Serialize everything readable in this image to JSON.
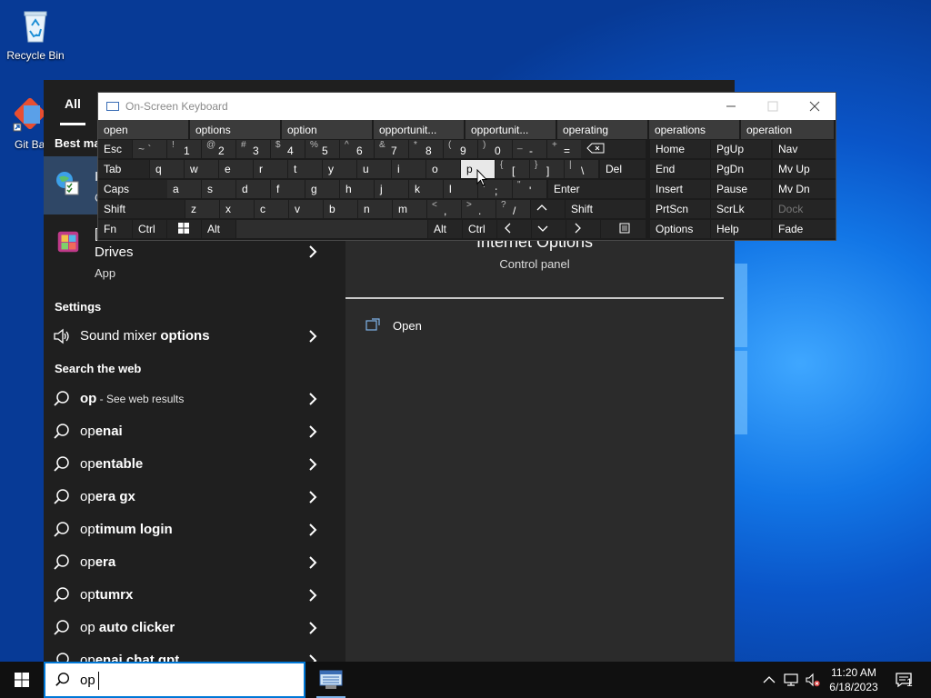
{
  "desktop": {
    "icons": [
      {
        "label": "Recycle Bin"
      },
      {
        "label": "Git Ba"
      }
    ]
  },
  "search_panel": {
    "tabs": {
      "all": "All"
    },
    "best_match_header": "Best ma",
    "best_item": {
      "letter1": "I",
      "letter2": "C"
    },
    "drives_item": {
      "line0": "[",
      "title": "Drives",
      "subtitle": "App"
    },
    "settings_header": "Settings",
    "settings_item": {
      "label_pre": "Sound mixer ",
      "label_bold": "options"
    },
    "web_header": "Search the web",
    "web_first": {
      "bold": "op",
      "suffix": " - See web results"
    },
    "web_results": [
      {
        "pre": "op",
        "bold": "enai"
      },
      {
        "pre": "op",
        "bold": "entable"
      },
      {
        "pre": "op",
        "bold": "era gx"
      },
      {
        "pre": "op",
        "bold": "timum login"
      },
      {
        "pre": "op",
        "bold": "era"
      },
      {
        "pre": "op",
        "bold": "tumrx"
      },
      {
        "pre": "op",
        "bold": " auto clicker"
      },
      {
        "pre": "op",
        "bold": "enai chat gpt"
      }
    ],
    "right": {
      "title": "Internet Options",
      "subtitle": "Control panel",
      "open_label": "Open"
    }
  },
  "osk": {
    "title": "On-Screen Keyboard",
    "predictions": [
      "open",
      "options",
      "option",
      "opportunit...",
      "opportunit...",
      "operating",
      "operations",
      "operation"
    ],
    "keys": {
      "esc": "Esc",
      "tab": "Tab",
      "caps": "Caps",
      "shift": "Shift",
      "fn": "Fn",
      "ctrl": "Ctrl",
      "alt": "Alt",
      "del": "Del",
      "enter": "Enter",
      "home": "Home",
      "pgup": "PgUp",
      "nav": "Nav",
      "end": "End",
      "pgdn": "PgDn",
      "mvup": "Mv Up",
      "insert": "Insert",
      "pause": "Pause",
      "mvdn": "Mv Dn",
      "prtscn": "PrtScn",
      "scrlk": "ScrLk",
      "dock": "Dock",
      "options": "Options",
      "help": "Help",
      "fade": "Fade",
      "tilde": "~ `",
      "num_row": [
        [
          "!",
          "1"
        ],
        [
          "@",
          "2"
        ],
        [
          "#",
          "3"
        ],
        [
          "$",
          "4"
        ],
        [
          "%",
          "5"
        ],
        [
          "^",
          "6"
        ],
        [
          "&",
          "7"
        ],
        [
          "*",
          "8"
        ],
        [
          "(",
          "9"
        ],
        [
          ")",
          "0"
        ],
        [
          "_",
          "-"
        ],
        [
          "+",
          "="
        ]
      ],
      "row_q": [
        "q",
        "w",
        "e",
        "r",
        "t",
        "y",
        "u",
        "i",
        "o",
        "p"
      ],
      "row_q_sym": [
        [
          "{",
          "["
        ],
        [
          "}",
          "]"
        ],
        [
          "|",
          "\\"
        ]
      ],
      "row_a": [
        "a",
        "s",
        "d",
        "f",
        "g",
        "h",
        "j",
        "k",
        "l"
      ],
      "row_a_sym": [
        [
          ":",
          ";"
        ],
        [
          "\"",
          "'"
        ]
      ],
      "row_z": [
        "z",
        "x",
        "c",
        "v",
        "b",
        "n",
        "m"
      ],
      "row_z_sym": [
        [
          "<",
          ","
        ],
        [
          ">",
          "."
        ],
        [
          "?",
          "/"
        ]
      ]
    }
  },
  "taskbar": {
    "search_text": "op",
    "time": "11:20 AM",
    "date": "6/18/2023",
    "notification_count": "1"
  }
}
